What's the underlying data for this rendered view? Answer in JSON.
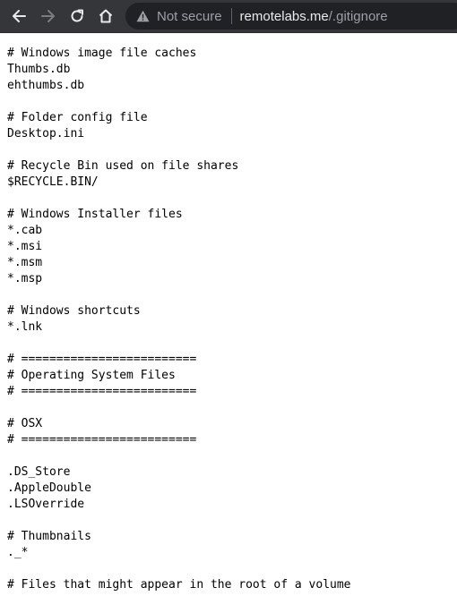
{
  "browser": {
    "security_label": "Not secure",
    "url_host": "remotelabs.me",
    "url_path": "/.gitignore",
    "colors": {
      "toolbar": "#35363a",
      "omnibox": "#202124",
      "icon": "#e8eaed",
      "icon_disabled": "#7a7c80"
    }
  },
  "file": {
    "lines": [
      "# Windows image file caches",
      "Thumbs.db",
      "ehthumbs.db",
      "",
      "# Folder config file",
      "Desktop.ini",
      "",
      "# Recycle Bin used on file shares",
      "$RECYCLE.BIN/",
      "",
      "# Windows Installer files",
      "*.cab",
      "*.msi",
      "*.msm",
      "*.msp",
      "",
      "# Windows shortcuts",
      "*.lnk",
      "",
      "# =========================",
      "# Operating System Files",
      "# =========================",
      "",
      "# OSX",
      "# =========================",
      "",
      ".DS_Store",
      ".AppleDouble",
      ".LSOverride",
      "",
      "# Thumbnails",
      "._*",
      "",
      "# Files that might appear in the root of a volume"
    ]
  }
}
